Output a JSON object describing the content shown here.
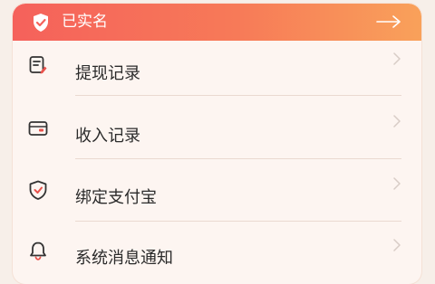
{
  "verification": {
    "status_label": "已实名"
  },
  "menu": {
    "items": [
      {
        "label": "提现记录",
        "icon": "withdraw-record-icon"
      },
      {
        "label": "收入记录",
        "icon": "wallet-card-icon"
      },
      {
        "label": "绑定支付宝",
        "icon": "shield-check-icon"
      },
      {
        "label": "系统消息通知",
        "icon": "bell-icon"
      }
    ]
  },
  "colors": {
    "banner_start": "#f5615b",
    "banner_end": "#f9a15a",
    "icon_accent": "#e8524c",
    "text": "#2b2b2b"
  }
}
